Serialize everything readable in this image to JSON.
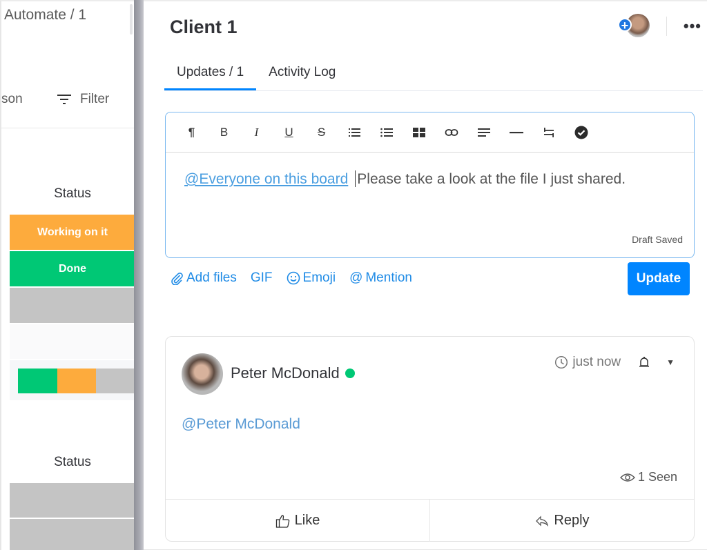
{
  "board": {
    "tab_label": "Automate / 1",
    "person_label": "son",
    "filter_label": "Filter",
    "filter_icon": "filter-icon",
    "groups": [
      {
        "column_header": "Status",
        "cells": [
          {
            "label": "Working on it",
            "color": "#fdab3d"
          },
          {
            "label": "Done",
            "color": "#00c875"
          },
          {
            "label": "",
            "color": "#c4c4c4"
          }
        ],
        "summary": [
          {
            "status": "Done",
            "fraction": 0.333,
            "color": "#00c875"
          },
          {
            "status": "Working on it",
            "fraction": 0.333,
            "color": "#fdab3d"
          },
          {
            "status": "Empty",
            "fraction": 0.334,
            "color": "#c4c4c4"
          }
        ]
      },
      {
        "column_header": "Status",
        "cells": [
          {
            "label": "",
            "color": "#c4c4c4"
          },
          {
            "label": "",
            "color": "#c4c4c4"
          }
        ]
      }
    ]
  },
  "panel": {
    "title": "Client 1",
    "add_subscriber_icon": "plus-icon",
    "more_label": "•••",
    "tabs": [
      {
        "label": "Updates / 1",
        "active": true
      },
      {
        "label": "Activity Log",
        "active": false
      }
    ],
    "toolbar": [
      {
        "name": "paragraph",
        "glyph": "¶"
      },
      {
        "name": "bold",
        "glyph": "B"
      },
      {
        "name": "italic",
        "glyph": "I"
      },
      {
        "name": "underline",
        "glyph": "U"
      },
      {
        "name": "strikethrough",
        "glyph": "S"
      },
      {
        "name": "numbered-list",
        "glyph": ""
      },
      {
        "name": "bulleted-list",
        "glyph": ""
      },
      {
        "name": "table",
        "glyph": ""
      },
      {
        "name": "link",
        "glyph": ""
      },
      {
        "name": "align",
        "glyph": ""
      },
      {
        "name": "divider",
        "glyph": ""
      },
      {
        "name": "direction",
        "glyph": ""
      },
      {
        "name": "checklist",
        "glyph": ""
      }
    ],
    "editor": {
      "mention": "@Everyone on this board",
      "text": "Please take a look at the file I just shared.",
      "draft_status": "Draft Saved"
    },
    "composer_actions": {
      "add_files": "Add files",
      "gif": "GIF",
      "emoji": "Emoji",
      "mention": "Mention"
    },
    "update_button": "Update",
    "post": {
      "author": "Peter McDonald",
      "online": true,
      "timestamp": "just now",
      "body": "@Peter McDonald",
      "seen": "1 Seen",
      "like_label": "Like",
      "reply_label": "Reply"
    }
  }
}
